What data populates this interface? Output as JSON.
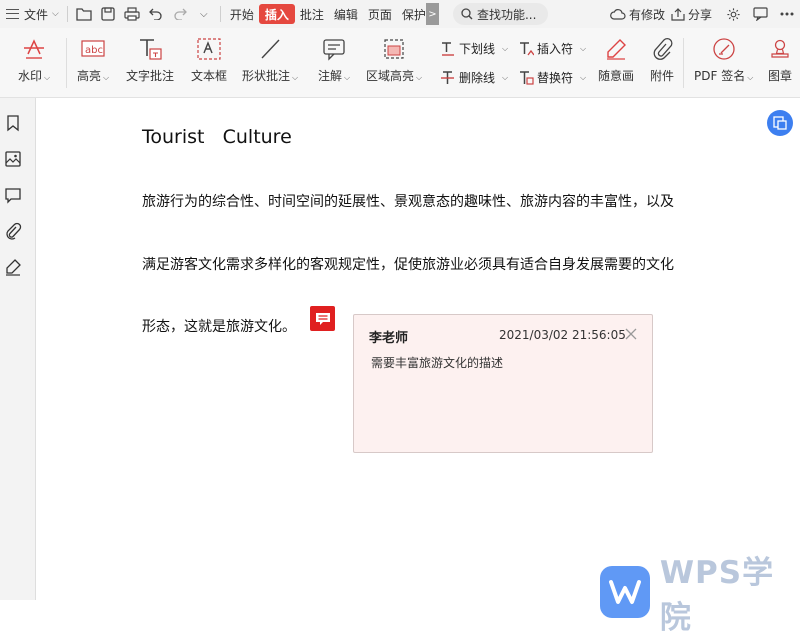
{
  "titlebar": {
    "file_menu": "文件",
    "tabs": [
      "开始",
      "插入",
      "批注",
      "编辑",
      "页面",
      "保护"
    ],
    "active_tab": "插入",
    "more_tabs": ">",
    "search_placeholder": "查找功能...",
    "modified_label": "有修改",
    "share_label": "分享"
  },
  "ribbon": {
    "watermark": "水印",
    "highlight": "高亮",
    "highlight_icon_text": "abc",
    "text_annotation": "文字批注",
    "text_box": "文本框",
    "shape_annotation": "形状批注",
    "note": "注解",
    "area_highlight": "区域高亮",
    "underline": "下划线",
    "strikethrough": "删除线",
    "insert_char": "插入符",
    "replace_char": "替换符",
    "freehand": "随意画",
    "attachment": "附件",
    "pdf_sign": "PDF 签名",
    "stamp": "图章"
  },
  "document": {
    "title": "Tourist   Culture",
    "paragraph_lines": [
      "旅游行为的综合性、时间空间的延展性、景观意态的趣味性、旅游内容的丰富性，以及",
      "满足游客文化需求多样化的客观规定性，促使旅游业必须具有适合自身发展需要的文化",
      "形态，这就是旅游文化。"
    ]
  },
  "comment": {
    "author": "李老师",
    "timestamp": "2021/03/02 21:56:05",
    "text": "需要丰富旅游文化的描述"
  },
  "watermark_brand": "WPS学院",
  "colors": {
    "accent_red": "#e5483f",
    "comment_marker": "#e02020",
    "comment_bg": "#fdf1f0",
    "float_button": "#3d7ff0"
  }
}
